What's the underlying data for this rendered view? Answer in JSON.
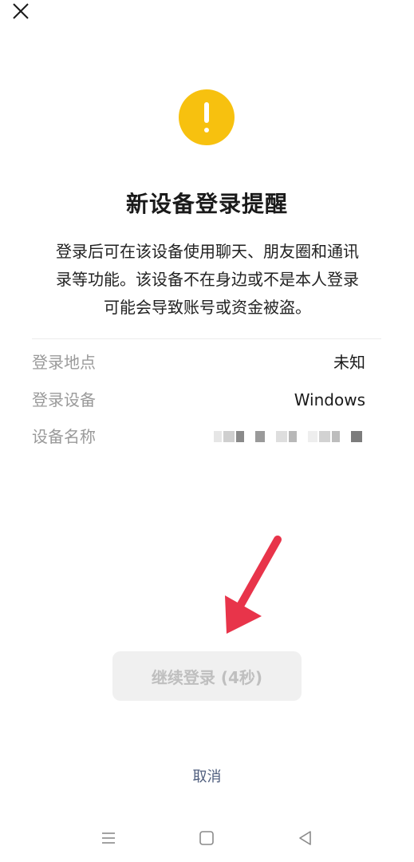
{
  "header": {
    "close_icon": "close-icon"
  },
  "alert": {
    "icon": "warning-icon",
    "icon_color": "#f7c10f",
    "title": "新设备登录提醒",
    "description_lines": [
      "登录后可在该设备使用聊天、朋友圈和通讯",
      "录等功能。该设备不在身边或不是本人登录",
      "可能会导致账号或资金被盗。"
    ]
  },
  "details": {
    "location": {
      "label": "登录地点",
      "value": "未知"
    },
    "device": {
      "label": "登录设备",
      "value": "Windows"
    },
    "device_name": {
      "label": "设备名称",
      "value_icon": "pixelated-redacted-text"
    }
  },
  "annotation": {
    "icon": "red-arrow-icon",
    "color": "#e8344a"
  },
  "actions": {
    "continue_label": "继续登录 (4秒)",
    "cancel_label": "取消",
    "cancel_color": "#4e5d7d"
  },
  "nav": {
    "menu_icon": "menu-icon",
    "home_icon": "home-icon",
    "back_icon": "back-icon"
  }
}
